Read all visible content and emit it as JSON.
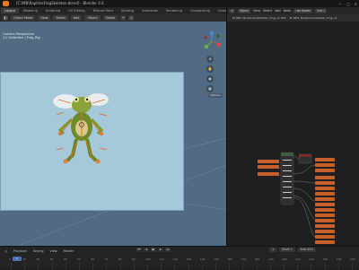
{
  "window": {
    "title": "[C:\\MB\\RaptilesFrogSkeleton.blend] - Blender 4.0",
    "controls": [
      "—",
      "▢",
      "✕"
    ]
  },
  "workspaces": {
    "tabs": [
      "Layout",
      "Modeling",
      "Sculpting",
      "UV Editing",
      "Texture Paint",
      "Shading",
      "Animation",
      "Rendering",
      "Compositing",
      "Geometry Nodes",
      "Scripting"
    ],
    "active_index": 0
  },
  "viewport_header": {
    "mode": "Object Mode",
    "menus": [
      "View",
      "Select",
      "Add",
      "Object"
    ],
    "transform": "Global"
  },
  "viewport": {
    "overlay_text": "Camera Perspective",
    "overlay_subtext": "(1) Collection | Frog_Rig",
    "side_tab": "Options"
  },
  "node_editor": {
    "header_items": [
      "Object",
      "View",
      "Select",
      "Add",
      "Node"
    ],
    "use_nodes_label": "Use Nodes",
    "slot": "Slot 1",
    "breadcrumbs": [
      "M_NEO_BodyAnimeShader_Frog_v1.001",
      "M_NEO_BodyAnimeShader_Frog_v1"
    ]
  },
  "timeline": {
    "menus": [
      "Playback",
      "Keying",
      "View",
      "Marker"
    ],
    "current_frame": "1",
    "start_label": "Start",
    "start": "1",
    "end_label": "End",
    "end": "250",
    "ticks": [
      "0",
      "10",
      "20",
      "30",
      "40",
      "50",
      "60",
      "70",
      "80",
      "90",
      "100",
      "110",
      "120",
      "130",
      "140",
      "150",
      "160",
      "170",
      "180",
      "190",
      "200",
      "210",
      "220",
      "230",
      "240",
      "250"
    ]
  },
  "colors": {
    "accent": "#e87d0d",
    "viewport_bg": "#516b82",
    "camera_bg": "#a5c8da",
    "node_orange": "#c8602a",
    "playhead": "#4772b3"
  },
  "icons": {
    "gizmo": "navigation-gizmo-icon",
    "zoom": "zoom-icon",
    "pan": "pan-hand-icon",
    "camera": "camera-icon",
    "grid": "perspective-grid-icon"
  }
}
